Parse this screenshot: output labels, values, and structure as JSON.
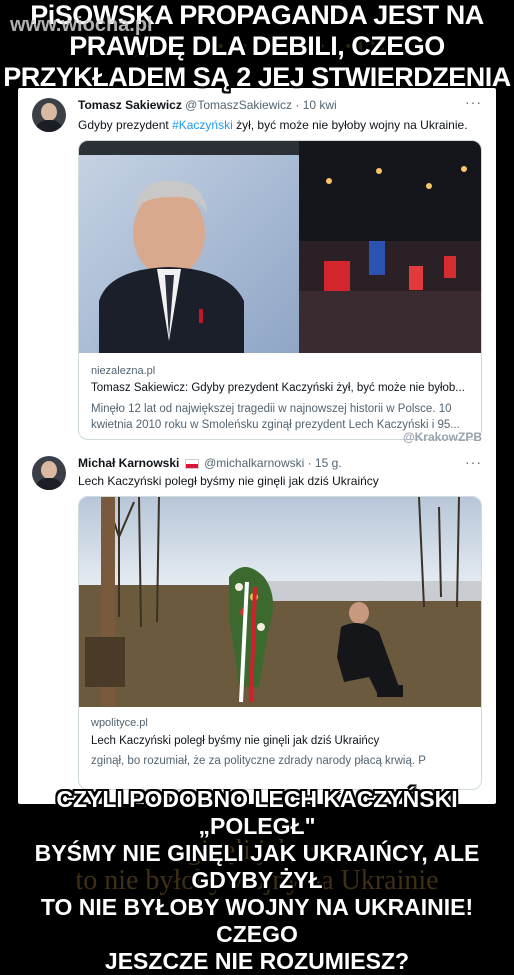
{
  "watermark": "www.wiocha.pl",
  "meme_top": {
    "line1": "PiSOWSKA PROPAGANDA JEST NA",
    "line2": "PRAWDĘ DLA DEBILI, CZEGO",
    "line3": "PRZYKŁADEM SĄ 2 JEJ STWIERDZENIA"
  },
  "tweet1": {
    "name": "Tomasz Sakiewicz",
    "handle": "@TomaszSakiewicz · 10 kwi",
    "more": "···",
    "text_before": "Gdyby prezydent ",
    "hashtag": "#Kaczyński",
    "text_after": " żył, być może nie byłoby wojny na Ukrainie.",
    "link": {
      "domain": "niezalezna.pl",
      "title": "Tomasz Sakiewicz: Gdyby prezydent Kaczyński żył, być może nie byłob...",
      "description": "Minęło 12 lat od największej tragedii w najnowszej historii w Polsce. 10 kwietnia 2010 roku w Smoleńsku zginął prezydent Lech Kaczyński i 95..."
    },
    "credit": "@KrakowZPB"
  },
  "tweet2": {
    "name": "Michał Karnowski",
    "handle": "@michalkarnowski · 15 g.",
    "more": "···",
    "text": "Lech Kaczyński poległ byśmy nie ginęli jak dziś Ukraińcy",
    "link": {
      "domain": "wpolityce.pl",
      "title": "Lech Kaczyński poległ byśmy nie ginęli jak dziś Ukraińcy",
      "description": "zginął, bo rozumiał, że za polityczne zdrady narody płacą krwią. P"
    }
  },
  "meme_bottom": {
    "line1": "CZYLI PODOBNO LECH KACZYŃSKI „POLEGŁ\"",
    "line2": "BYŚMY NIE GINĘLI JAK UKRAIŃCY, ALE GDYBY ŻYŁ",
    "line3": "TO NIE BYŁOBY WOJNY NA UKRAINIE! CZEGO",
    "line4": "JESZCZE NIE ROZUMIESZ?"
  }
}
